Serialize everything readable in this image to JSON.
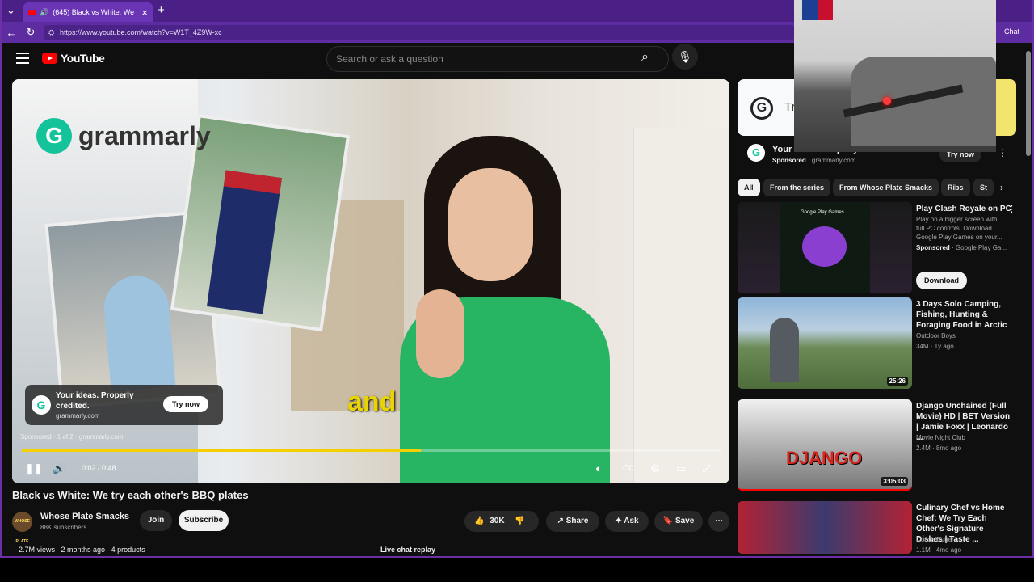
{
  "browser": {
    "tab_title": "(645) Black vs White: We try e",
    "url": "https://www.youtube.com/watch?v=W1T_4Z9W-xc",
    "chat_label": "Chat",
    "icons": [
      "back-icon",
      "reload-icon",
      "tab-menu-icon",
      "speaker-icon",
      "close-icon",
      "new-tab-icon"
    ]
  },
  "masthead": {
    "logo_text": "YouTube",
    "search_placeholder": "Search or ask a question"
  },
  "player": {
    "brand": "grammarly",
    "caption": "and",
    "ad_card": {
      "line1": "Your ideas. Properly credited.",
      "domain": "grammarly.com",
      "cta": "Try now"
    },
    "ad_meta": "Sponsored · 1 of 2 · grammarly.com",
    "time": "0:02 / 0:48",
    "progress_fraction": 0.57
  },
  "video": {
    "title": "Black vs White: We try each other's BBQ plates",
    "channel": "Whose Plate Smacks",
    "channel_avatar_text": "WHOSE PLATE SMACKS",
    "subscribers": "88K subscribers",
    "join": "Join",
    "subscribe": "Subscribe",
    "likes": "30K",
    "share": "Share",
    "ask": "Ask",
    "save": "Save",
    "views": "2.7M views",
    "age": "2 months ago",
    "products": "4 products",
    "live_chat": "Live chat replay"
  },
  "sidebar": {
    "ad": {
      "banner_text": "Tr",
      "headline": "Your ideas. Properly credited.",
      "sponsored": "Sponsored",
      "domain": "grammarly.com",
      "cta": "Try now"
    },
    "chips": [
      "All",
      "From the series",
      "From Whose Plate Smacks",
      "Ribs",
      "St"
    ],
    "videos": [
      {
        "title": "Play Clash Royale on PC",
        "desc": "Play on a bigger screen with full PC controls. Download Google Play Games on your...",
        "sponsor": "Sponsored",
        "sponsor_name": "Google Play Ga...",
        "cta": "Download",
        "thumb_label": "Google Play Games"
      },
      {
        "title": "3 Days Solo Camping, Fishing, Hunting & Foraging Food in Arctic",
        "channel": "Outdoor Boys",
        "meta": "34M · 1y ago",
        "duration": "25:26"
      },
      {
        "title": "Django Unchained (Full Movie) HD | BET Version | Jamie Foxx | Leonardo ...",
        "channel": "Movie Night Club",
        "meta": "2.4M · 8mo ago",
        "duration": "3:05:03",
        "thumb_label": "DJANGO"
      },
      {
        "title": "Culinary Chef vs Home Chef: We Try Each Other's Signature Dishes  | Taste ...",
        "channel": "Cocoa Butter",
        "meta": "1.1M · 4mo ago"
      }
    ]
  }
}
